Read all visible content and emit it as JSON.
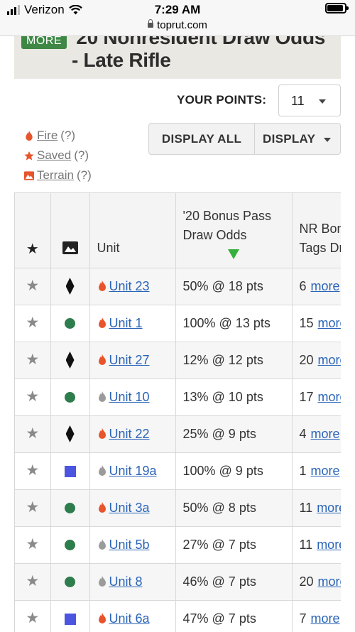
{
  "status_bar": {
    "carrier": "Verizon",
    "time": "7:29 AM"
  },
  "browser": {
    "url": "toprut.com"
  },
  "header": {
    "badge": "MORE",
    "title": "'20 Nonresident Draw Odds - Late Rifle"
  },
  "points": {
    "label": "YOUR POINTS:",
    "value": "11"
  },
  "legend": {
    "fire": {
      "label": "Fire",
      "help": "(?)"
    },
    "saved": {
      "label": "Saved",
      "help": "(?)"
    },
    "terrain": {
      "label": "Terrain",
      "help": "(?)"
    }
  },
  "display": {
    "all_label": "DISPLAY ALL",
    "menu_label": "DISPLAY"
  },
  "table": {
    "columns": {
      "unit": "Unit",
      "bonus_line1": "'20 Bonus Pass",
      "bonus_line2": "Draw Odds",
      "tags_line1": "NR Bonus",
      "tags_line2": "Tags Drawn"
    },
    "more_label": "more",
    "rows": [
      {
        "unit": "Unit 23",
        "fire": "red",
        "terrain": "diamond",
        "odds": "50% @ 18 pts",
        "tags": "6"
      },
      {
        "unit": "Unit 1",
        "fire": "red",
        "terrain": "circle",
        "odds": "100% @ 13 pts",
        "tags": "15"
      },
      {
        "unit": "Unit 27",
        "fire": "red",
        "terrain": "diamond",
        "odds": "12% @ 12 pts",
        "tags": "20"
      },
      {
        "unit": "Unit 10",
        "fire": "gray",
        "terrain": "circle",
        "odds": "13% @ 10 pts",
        "tags": "17"
      },
      {
        "unit": "Unit 22",
        "fire": "red",
        "terrain": "diamond",
        "odds": "25% @ 9 pts",
        "tags": "4"
      },
      {
        "unit": "Unit 19a",
        "fire": "gray",
        "terrain": "square",
        "odds": "100% @ 9 pts",
        "tags": "1"
      },
      {
        "unit": "Unit 3a",
        "fire": "red",
        "terrain": "circle",
        "odds": "50% @ 8 pts",
        "tags": "11"
      },
      {
        "unit": "Unit 5b",
        "fire": "gray",
        "terrain": "circle",
        "odds": "27% @ 7 pts",
        "tags": "11"
      },
      {
        "unit": "Unit 8",
        "fire": "gray",
        "terrain": "circle",
        "odds": "46% @ 7 pts",
        "tags": "20"
      },
      {
        "unit": "Unit 6a",
        "fire": "red",
        "terrain": "square",
        "odds": "47% @ 7 pts",
        "tags": "7"
      }
    ]
  },
  "colors": {
    "accent_green": "#3e8745",
    "fire_red": "#e8542c",
    "fire_gray": "#9b9b9b",
    "link_blue": "#2a64b8",
    "terrain_circle": "#2e7d4c",
    "terrain_square": "#4c55e0",
    "sort_arrow": "#35b03a"
  }
}
